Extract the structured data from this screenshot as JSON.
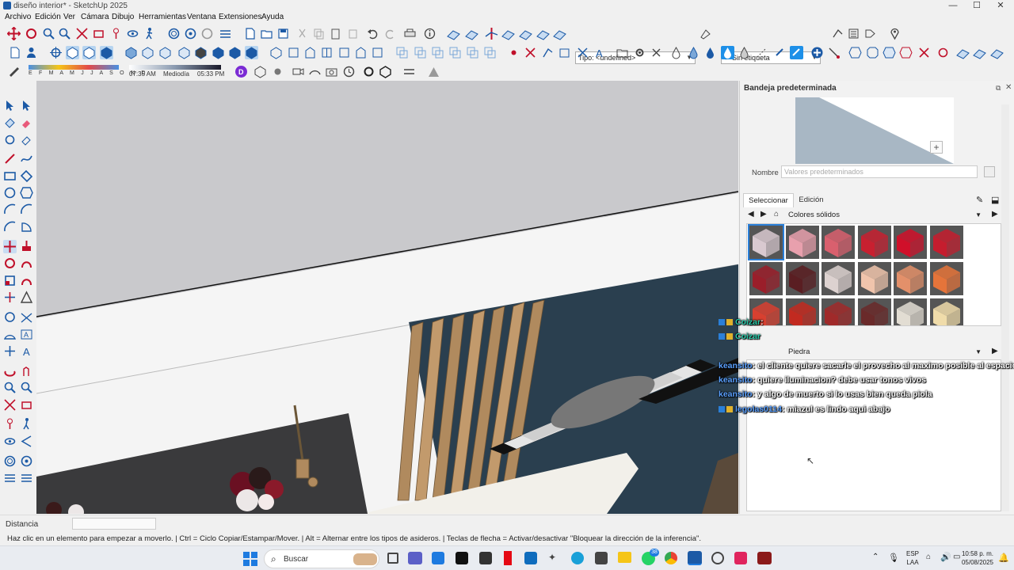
{
  "window": {
    "title": "diseño interior* - SketchUp 2025",
    "min": "—",
    "max": "☐",
    "close": "✕"
  },
  "menu": [
    "Archivo",
    "Edición",
    "Ver",
    "Cámara",
    "Dibujo",
    "Herramientas",
    "Ventana",
    "Extensiones",
    "Ayuda"
  ],
  "toolbar": {
    "type_select": "Tipo: <undefined>",
    "tag_select": "Sin etiqueta",
    "months": "E F M A M J J A S O N D",
    "time_start": "07:35 AM",
    "time_mid": "Mediodía",
    "time_end": "05:33 PM"
  },
  "tray": {
    "title": "Bandeja predeterminada",
    "name_label": "Nombre",
    "name_placeholder": "Valores predeterminados",
    "tab_select": "Seleccionar",
    "tab_edit": "Edición",
    "collection": "Colores sólidos",
    "secondary_collection": "Piedra",
    "swatches": [
      "#d9c9d0",
      "#e8a0ad",
      "#d9606e",
      "#c82030",
      "#d0102a",
      "#c51d2e",
      "#9a1e2a",
      "#5a1e22",
      "#ddd2d0",
      "#f0c4ac",
      "#e3906a",
      "#e5743a",
      "#d84030",
      "#c22a20",
      "#a02a2a",
      "#6a2a2a",
      "#e2ddd3",
      "#f0dcaa"
    ]
  },
  "chat": [
    {
      "user": "Coizar",
      "msg": ": ",
      "user_class": "teal"
    },
    {
      "user": "Coizar",
      "msg": "",
      "user_class": "teal"
    },
    {
      "user": "keansito",
      "msg": ": el cliente quiere sacarle el provecho al maximo posible al espacio",
      "user_class": ""
    },
    {
      "user": "keansito",
      "msg": ": quiere iluminacion? debe usar tonos vivos",
      "user_class": ""
    },
    {
      "user": "keansito",
      "msg": ": y algo de muerto si lo usas bien queda piola",
      "user_class": ""
    },
    {
      "user": "legolas0114",
      "msg": ": miazul es lindo aqui abajo",
      "user_class": ""
    }
  ],
  "status": {
    "distance_label": "Distancia",
    "distance_value": "",
    "hint": "Haz clic en un elemento para empezar a moverlo. | Ctrl = Ciclo Copiar/Estampar/Mover. | Alt = Alternar entre los tipos de asideros. | Teclas de flecha = Activar/desactivar \"Bloquear la dirección de la inferencia\"."
  },
  "taskbar": {
    "search": "Buscar",
    "lang_top": "ESP",
    "lang_bottom": "LAA",
    "time": "10:58 p. m.",
    "date": "05/08/2025",
    "whatsapp_badge": "38"
  },
  "colors": {
    "wall_blue": "#2a3f4f",
    "wood": "#b08a5e",
    "ceiling": "#f2f2f2",
    "accent_blue": "#1e6fd9"
  }
}
